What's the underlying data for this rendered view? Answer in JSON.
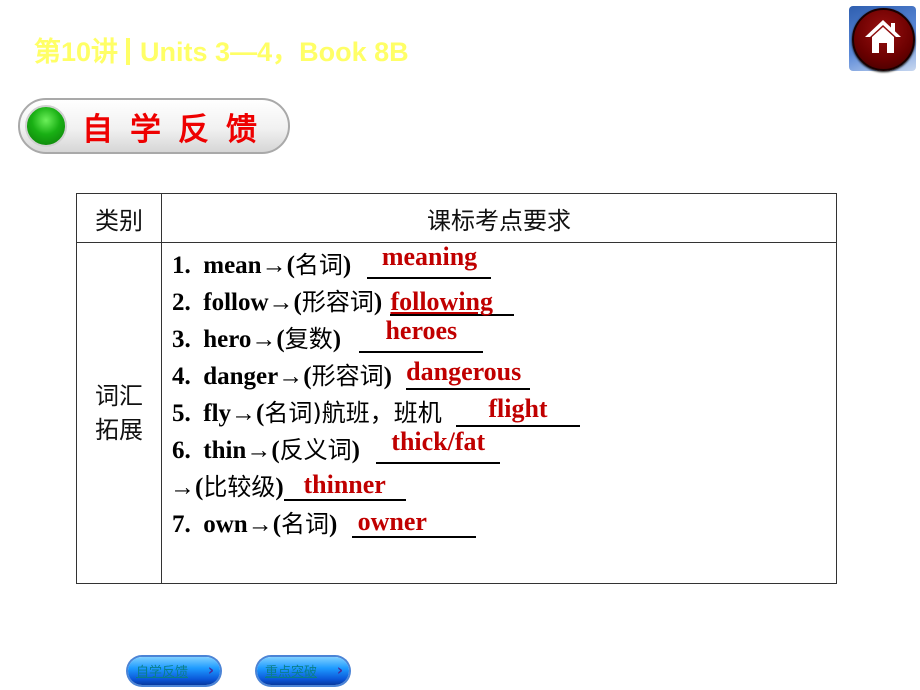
{
  "header": {
    "lecture": "第10讲",
    "subtitle": "Units 3—4，Book 8B",
    "home_icon": "home-icon"
  },
  "section": {
    "title": "自学反馈",
    "indicator_icon": "green-dot-icon"
  },
  "table": {
    "headers": [
      "类别",
      "课标考点要求"
    ],
    "category": "词汇拓展",
    "items": [
      {
        "num": "1.",
        "word": "mean→(",
        "hint": "名词",
        "tail": ")",
        "answer": "meaning"
      },
      {
        "num": "2.",
        "word": "follow→(",
        "hint": "形容词",
        "tail": ")",
        "answer": "following"
      },
      {
        "num": "3.",
        "word": "hero→(",
        "hint": "复数",
        "tail": ")",
        "answer": "heroes"
      },
      {
        "num": "4.",
        "word": "danger→(",
        "hint": "形容词",
        "tail": ")",
        "answer": "dangerous"
      },
      {
        "num": "5.",
        "word": "fly→(",
        "hint": "名词",
        "tail": ")航班，班机",
        "answer": "flight"
      },
      {
        "num": "6.",
        "word": "thin→(",
        "hint": "反义词",
        "tail": ")",
        "answer": "thick/fat"
      },
      {
        "num": "",
        "word": "→(",
        "hint": "比较级",
        "tail": ")",
        "answer": "thinner"
      },
      {
        "num": "7.",
        "word": "own→(",
        "hint": "名词",
        "tail": ")",
        "answer": "owner"
      }
    ]
  },
  "footer_nav": [
    {
      "label": "自学反馈",
      "icon": "chevron-right-icon"
    },
    {
      "label": "重点突破",
      "icon": "chevron-right-icon"
    }
  ],
  "colors": {
    "title": "#ffff66",
    "answer": "#c00000",
    "section_label": "#ee0000"
  }
}
